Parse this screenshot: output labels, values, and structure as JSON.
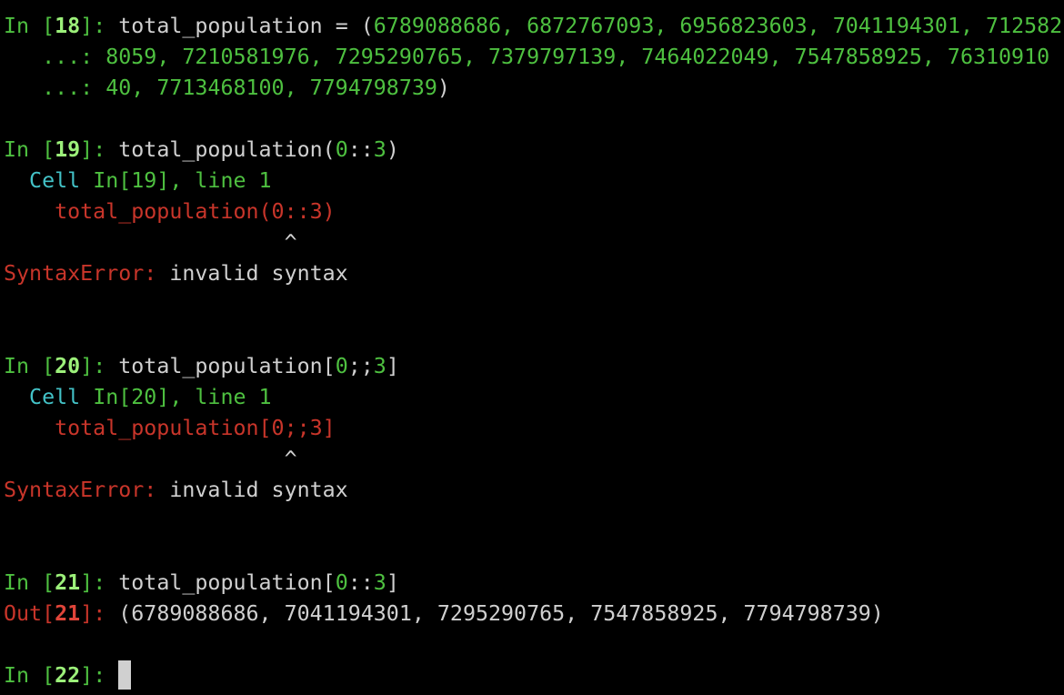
{
  "cell18": {
    "prompt_in": "In [",
    "number": "18",
    "prompt_close": "]: ",
    "code_name": "total_population = (",
    "line1_values": "6789088686, 6872767093, 6956823603, 7041194301, 712582",
    "cont_prompt": "   ...: ",
    "line2_values": "8059, 7210581976, 7295290765, 7379797139, 7464022049, 7547858925, 76310910",
    "line3_values": "40, 7713468100, 7794798739",
    "line3_close": ")"
  },
  "cell19": {
    "prompt_in": "In [",
    "number": "19",
    "prompt_close": "]: ",
    "code_pre": "total_population(",
    "code_num1": "0",
    "code_sep": "::",
    "code_num2": "3",
    "code_post": ")",
    "cell_ref": "  Cell ",
    "cell_loc": "In[19], line 1",
    "err_code": "    total_population(0::3)",
    "caret": "                      ^",
    "err_type": "SyntaxError:",
    "err_msg": " invalid syntax"
  },
  "cell20": {
    "prompt_in": "In [",
    "number": "20",
    "prompt_close": "]: ",
    "code_pre": "total_population[",
    "code_num1": "0",
    "code_sep": ";;",
    "code_num2": "3",
    "code_post": "]",
    "cell_ref": "  Cell ",
    "cell_loc": "In[20], line 1",
    "err_code": "    total_population[0;;3]",
    "caret": "                      ^",
    "err_type": "SyntaxError:",
    "err_msg": " invalid syntax"
  },
  "cell21": {
    "prompt_in": "In [",
    "number": "21",
    "prompt_close": "]: ",
    "code_pre": "total_population[",
    "code_num1": "0",
    "code_sep": "::",
    "code_num2": "3",
    "code_post": "]",
    "out_label": "Out[",
    "out_number": "21",
    "out_close": "]: ",
    "out_value": "(6789088686, 7041194301, 7295290765, 7547858925, 7794798739)"
  },
  "cell22": {
    "prompt_in": "In [",
    "number": "22",
    "prompt_close": "]: "
  }
}
